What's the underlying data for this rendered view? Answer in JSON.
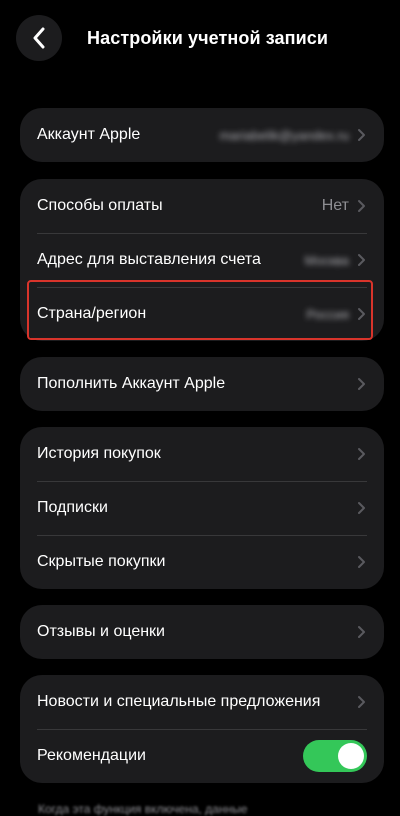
{
  "header": {
    "title": "Настройки учетной записи",
    "back_icon": "chevron-left-icon"
  },
  "groups": {
    "account": {
      "label": "Аккаунт Apple",
      "value": "mariabelik@yandex.ru"
    },
    "billing": {
      "payment_label": "Способы оплаты",
      "payment_value": "Нет",
      "address_label": "Адрес для выставления счета",
      "address_value": "Москва",
      "country_label": "Страна/регион",
      "country_value": "Россия"
    },
    "topup": {
      "label": "Пополнить Аккаунт Apple"
    },
    "purchases": {
      "history_label": "История покупок",
      "subscriptions_label": "Подписки",
      "hidden_label": "Скрытые покупки"
    },
    "reviews": {
      "label": "Отзывы и оценки"
    },
    "news": {
      "offers_label": "Новости и специальные предложения",
      "recommendations_label": "Рекомендации",
      "recommendations_enabled": true
    }
  },
  "footnote": "Когда эта функция включена, данные",
  "colors": {
    "background": "#000000",
    "card": "#1c1c1e",
    "toggle_on": "#34c759",
    "highlight": "#d9342b",
    "secondary_text": "#8e8e93"
  }
}
